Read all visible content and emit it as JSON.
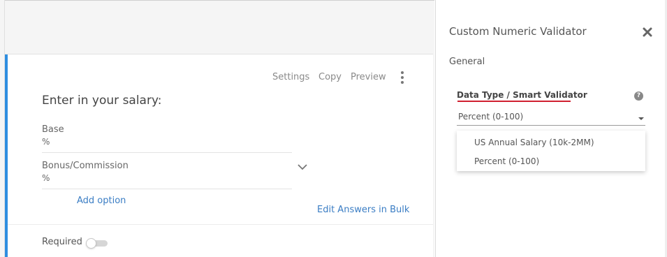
{
  "toolbar": {
    "settings": "Settings",
    "copy": "Copy",
    "preview": "Preview"
  },
  "question": {
    "title": "Enter in your salary:",
    "options": [
      {
        "label": "Base",
        "value": "%"
      },
      {
        "label": "Bonus/Commission",
        "value": "%"
      }
    ],
    "add_option": "Add option",
    "edit_bulk": "Edit Answers in Bulk",
    "required_label": "Required",
    "required_on": false
  },
  "panel": {
    "title": "Custom Numeric Validator",
    "section": "General",
    "data_type_label": "Data Type / Smart Validator",
    "help_glyph": "?",
    "selected": "Percent (0-100)",
    "dropdown_options": [
      "US Annual Salary (10k-2MM)",
      "Percent (0-100)"
    ],
    "accent_color": "#d02030"
  },
  "colors": {
    "card_accent": "#2f8ee0",
    "link": "#3a7dc4"
  }
}
